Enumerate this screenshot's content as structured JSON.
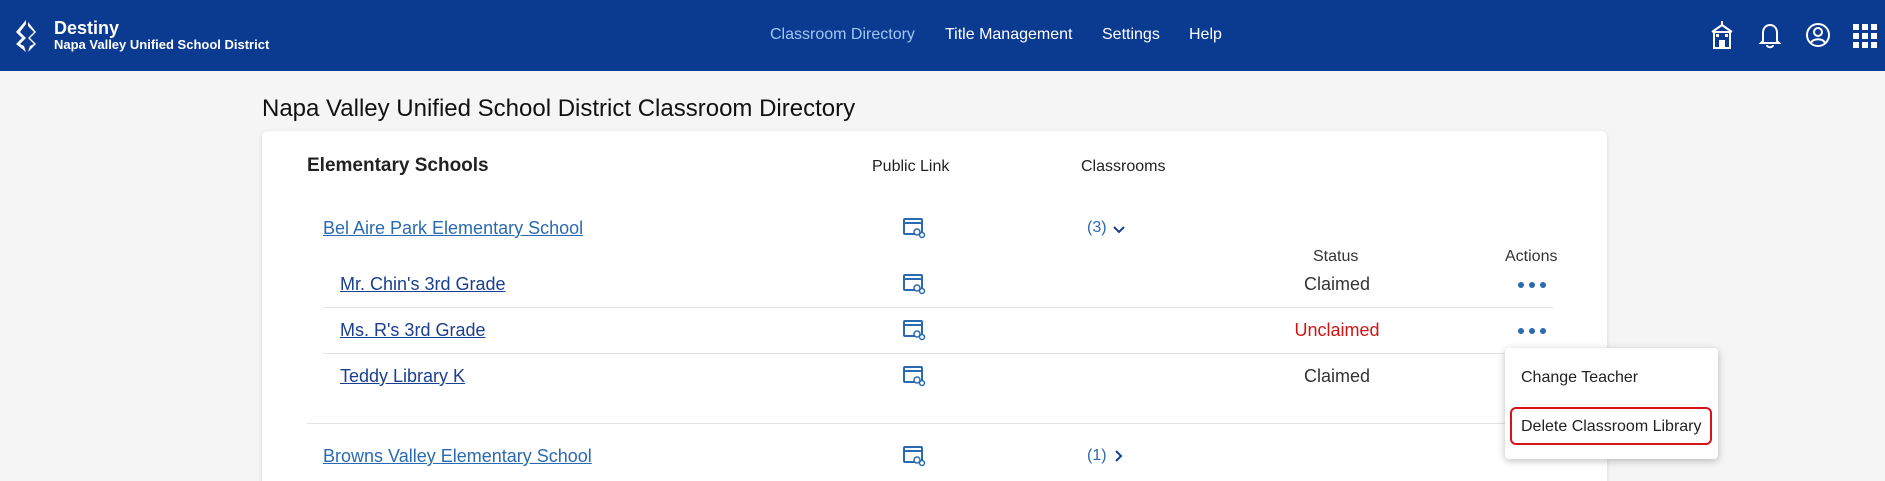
{
  "header": {
    "app_name": "Destiny",
    "district": "Napa Valley Unified School District",
    "nav": [
      "Classroom Directory",
      "Title Management",
      "Settings",
      "Help"
    ],
    "icons": [
      "school-icon",
      "bell-icon",
      "user-account-icon",
      "apps-grid-icon"
    ],
    "colors": {
      "bar": "#0b3a91",
      "active_nav": "#9ec7f2"
    }
  },
  "page": {
    "title": "Napa Valley Unified School District Classroom Directory"
  },
  "table": {
    "section_title": "Elementary Schools",
    "col_public_link": "Public Link",
    "col_classrooms": "Classrooms",
    "col_status": "Status",
    "col_actions": "Actions",
    "schools": [
      {
        "name": "Bel Aire Park Elementary School",
        "count": "(3)",
        "expanded": true,
        "classrooms": [
          {
            "name": "Mr. Chin's 3rd Grade",
            "status": "Claimed"
          },
          {
            "name": "Ms. R's 3rd Grade",
            "status": "Unclaimed"
          },
          {
            "name": "Teddy Library K",
            "status": "Claimed"
          }
        ]
      },
      {
        "name": "Browns Valley Elementary School",
        "count": "(1)",
        "expanded": false
      }
    ]
  },
  "actions_menu": {
    "items": [
      "Change Teacher",
      "Delete Classroom Library"
    ],
    "highlighted": "Delete Classroom Library",
    "highlight_color": "#d4141a"
  }
}
